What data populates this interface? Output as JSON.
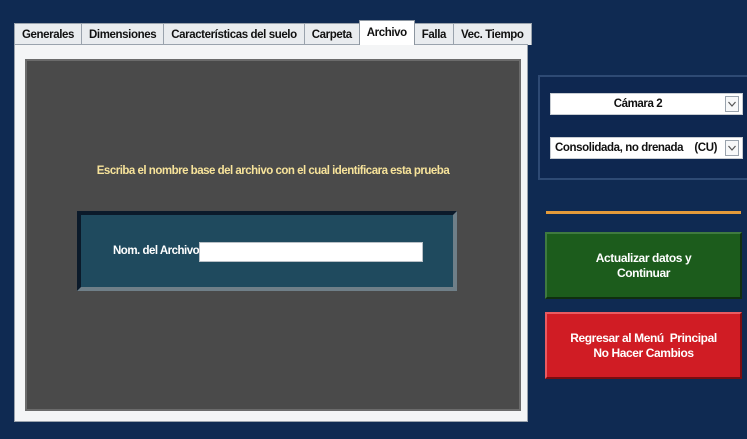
{
  "tabs": [
    {
      "label": "Generales",
      "active": false
    },
    {
      "label": "Dimensiones",
      "active": false
    },
    {
      "label": "Características del suelo",
      "active": false
    },
    {
      "label": "Carpeta",
      "active": false
    },
    {
      "label": "Archivo",
      "active": true
    },
    {
      "label": "Falla",
      "active": false
    },
    {
      "label": "Vec. Tiempo",
      "active": false
    }
  ],
  "panel": {
    "instruction": "Escriba el nombre base del archivo con el cual identificara esta prueba",
    "file_label": "Nom. del Archivo",
    "file_value": ""
  },
  "selectors": {
    "camera": "Cámara 2",
    "test_type": "Consolidada, no drenada    (CU)"
  },
  "buttons": {
    "update_line1": "Actualizar datos y",
    "update_line2": "Continuar",
    "return_line1": "Regresar al Menú  Principal",
    "return_line2": "No Hacer Cambios"
  },
  "colors": {
    "background": "#10284f",
    "panel_dark": "#4a4a4a",
    "file_box": "#1f4a5e",
    "instruction_text": "#f7e39a",
    "divider": "#e39a3a",
    "update_button": "#1c5c1c",
    "return_button": "#d01c24"
  },
  "icons": {
    "dropdown_arrow": "chevron-down-icon"
  }
}
